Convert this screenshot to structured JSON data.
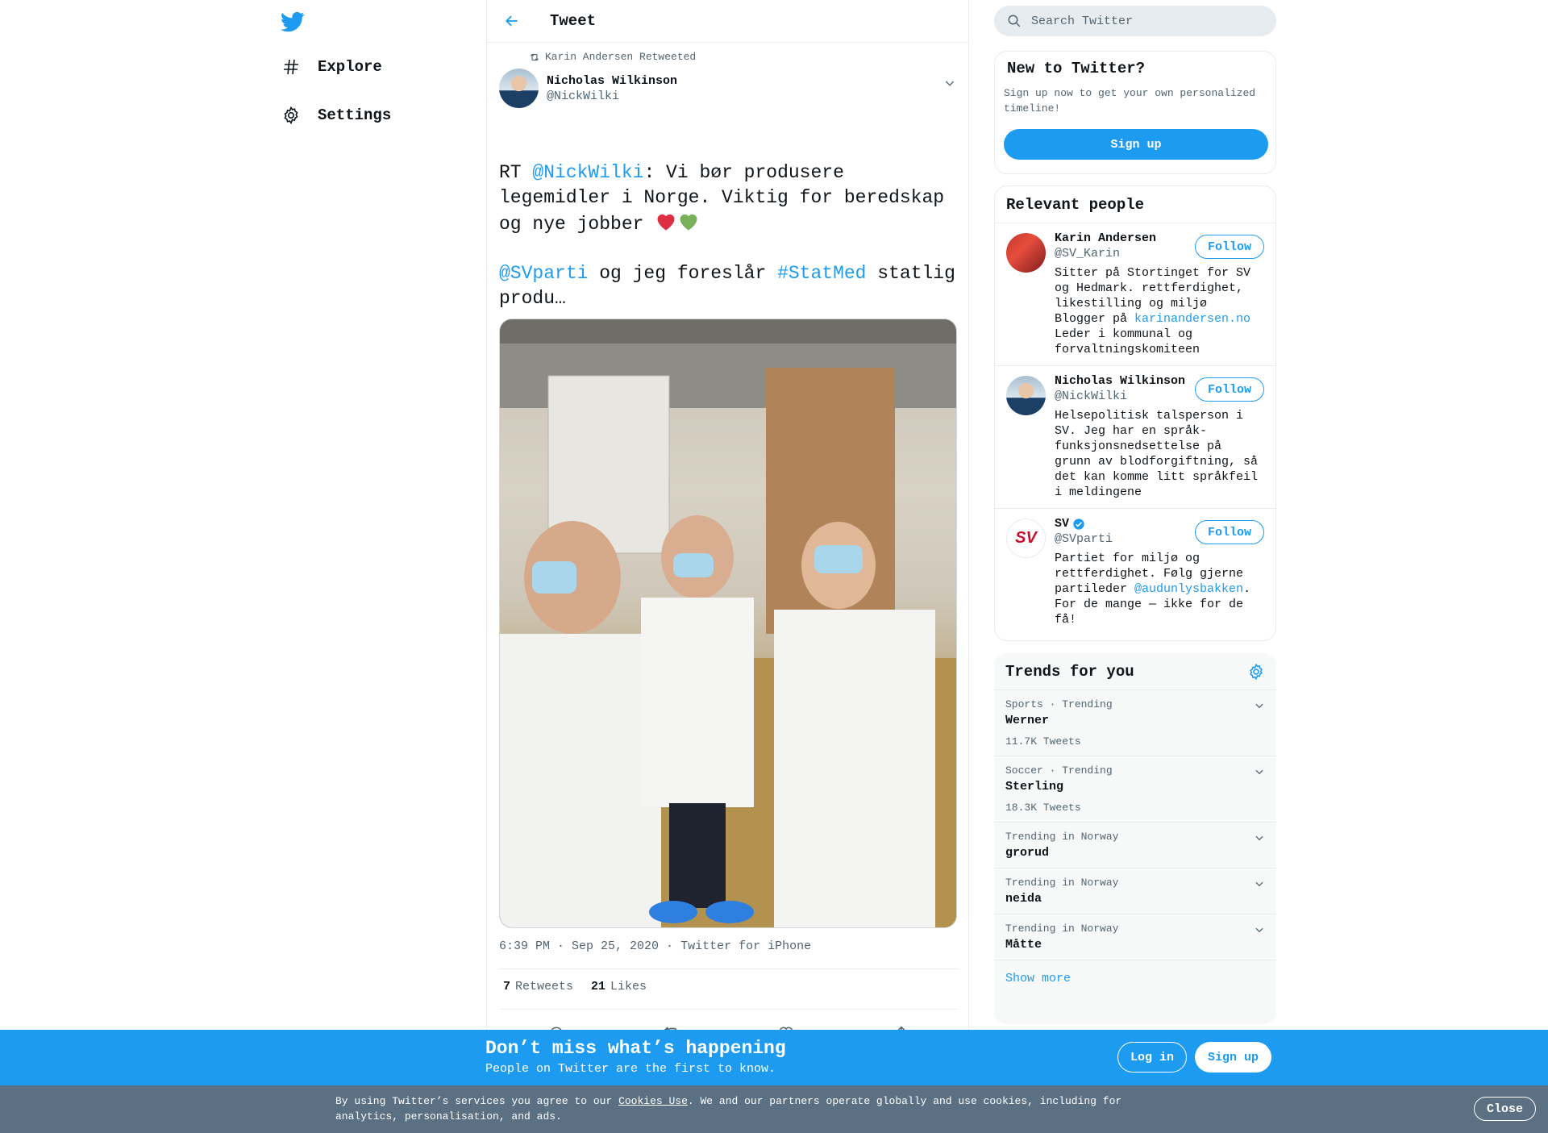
{
  "nav": {
    "explore": "Explore",
    "settings": "Settings"
  },
  "header": {
    "title": "Tweet"
  },
  "tweet": {
    "retweeted_by": "Karin Andersen Retweeted",
    "author_name": "Nicholas Wilkinson",
    "author_handle": "@NickWilki",
    "text_rt": "RT ",
    "text_mention": "@NickWilki",
    "text_body": ": Vi bør produsere legemidler i Norge. Viktig for beredskap og nye jobber ",
    "text_mention2": "@SVparti",
    "text_mid": " og jeg foreslår ",
    "text_hashtag": "#StatMed",
    "text_end": " statlig produ…",
    "time": "6:39 PM · Sep 25, 2020",
    "source": "Twitter for iPhone",
    "retweets_count": "7",
    "retweets_label": "Retweets",
    "likes_count": "21",
    "likes_label": "Likes"
  },
  "search": {
    "placeholder": "Search Twitter"
  },
  "new_to_twitter": {
    "title": "New to Twitter?",
    "subtitle": "Sign up now to get your own personalized timeline!",
    "signup": "Sign up"
  },
  "relevant_people": {
    "title": "Relevant people",
    "follow_label": "Follow",
    "people": [
      {
        "name": "Karin Andersen",
        "handle": "@SV_Karin",
        "bio_a": "Sitter på Stortinget for SV og Hedmark. rettferdighet, likestilling og miljø Blogger på ",
        "bio_link": "karinandersen.no",
        "bio_b": " Leder i kommunal og forvaltningskomiteen"
      },
      {
        "name": "Nicholas Wilkinson",
        "handle": "@NickWilki",
        "bio": "Helsepolitisk talsperson i SV. Jeg har en språk-funksjonsnedsettelse på grunn av blodforgiftning, så det kan komme litt språkfeil i meldingene"
      },
      {
        "name": "SV",
        "handle": "@SVparti",
        "bio_a": "Partiet for miljø og rettferdighet. Følg gjerne partileder ",
        "bio_link": "@audunlysbakken",
        "bio_b": ". For de mange — ikke for de få!",
        "logo_text": "SV"
      }
    ]
  },
  "trends": {
    "title": "Trends for you",
    "items": [
      {
        "category": "Sports · Trending",
        "name": "Werner",
        "count": "11.7K Tweets"
      },
      {
        "category": "Soccer · Trending",
        "name": "Sterling",
        "count": "18.3K Tweets"
      },
      {
        "category": "Trending in Norway",
        "name": "grorud"
      },
      {
        "category": "Trending in Norway",
        "name": "neida"
      },
      {
        "category": "Trending in Norway",
        "name": "Måtte"
      }
    ],
    "show_more": "Show more"
  },
  "banner": {
    "title": "Don’t miss what’s happening",
    "subtitle": "People on Twitter are the first to know.",
    "login": "Log in",
    "signup": "Sign up"
  },
  "cookie": {
    "text_a": "By using Twitter’s services you agree to our ",
    "link": "Cookies Use",
    "text_b": ". We and our partners operate globally and use cookies, including for analytics, personalisation, and ads.",
    "close": "Close"
  },
  "colors": {
    "accent": "#1d9bf0",
    "banner": "#1d9bf0",
    "cookie_bar": "#5b7083"
  },
  "icons": [
    "twitter-logo",
    "hash-icon",
    "gear-icon",
    "back-arrow-icon",
    "retweet-icon",
    "chevron-down-icon",
    "reply-icon",
    "like-icon",
    "share-icon",
    "search-icon",
    "verified-icon"
  ]
}
